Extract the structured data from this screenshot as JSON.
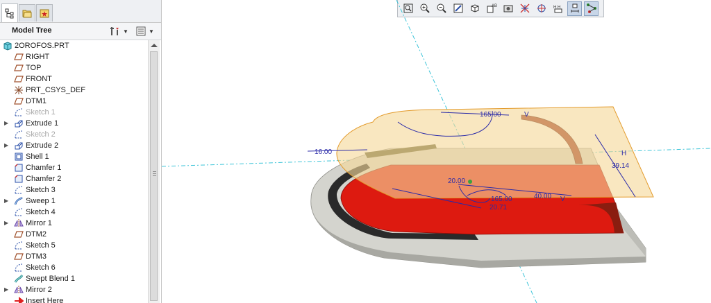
{
  "tabs": [
    {
      "name": "model-tree-tab-icon"
    },
    {
      "name": "folder-browser-tab-icon"
    },
    {
      "name": "favorites-tab-icon"
    }
  ],
  "tree_header": {
    "title": "Model Tree"
  },
  "tree": {
    "items": [
      {
        "label": "2OROFOS.PRT",
        "icon": "part-icon",
        "level": 0,
        "expand": false,
        "dim": false
      },
      {
        "label": "RIGHT",
        "icon": "datum-plane-icon",
        "level": 1,
        "expand": false,
        "dim": false
      },
      {
        "label": "TOP",
        "icon": "datum-plane-icon",
        "level": 1,
        "expand": false,
        "dim": false
      },
      {
        "label": "FRONT",
        "icon": "datum-plane-icon",
        "level": 1,
        "expand": false,
        "dim": false
      },
      {
        "label": "PRT_CSYS_DEF",
        "icon": "coordinate-system-icon",
        "level": 1,
        "expand": false,
        "dim": false
      },
      {
        "label": "DTM1",
        "icon": "datum-plane-icon",
        "level": 1,
        "expand": false,
        "dim": false
      },
      {
        "label": "Sketch 1",
        "icon": "sketch-icon",
        "level": 1,
        "expand": false,
        "dim": true
      },
      {
        "label": "Extrude 1",
        "icon": "extrude-icon",
        "level": 1,
        "expand": true,
        "dim": false
      },
      {
        "label": "Sketch 2",
        "icon": "sketch-icon",
        "level": 1,
        "expand": false,
        "dim": true
      },
      {
        "label": "Extrude 2",
        "icon": "extrude-icon",
        "level": 1,
        "expand": true,
        "dim": false
      },
      {
        "label": "Shell 1",
        "icon": "shell-icon",
        "level": 1,
        "expand": false,
        "dim": false
      },
      {
        "label": "Chamfer 1",
        "icon": "chamfer-icon",
        "level": 1,
        "expand": false,
        "dim": false
      },
      {
        "label": "Chamfer 2",
        "icon": "chamfer-icon",
        "level": 1,
        "expand": false,
        "dim": false
      },
      {
        "label": "Sketch 3",
        "icon": "sketch-icon",
        "level": 1,
        "expand": false,
        "dim": false
      },
      {
        "label": "Sweep 1",
        "icon": "sweep-icon",
        "level": 1,
        "expand": true,
        "dim": false
      },
      {
        "label": "Sketch 4",
        "icon": "sketch-icon",
        "level": 1,
        "expand": false,
        "dim": false
      },
      {
        "label": "Mirror 1",
        "icon": "mirror-icon",
        "level": 1,
        "expand": true,
        "dim": false
      },
      {
        "label": "DTM2",
        "icon": "datum-plane-icon",
        "level": 1,
        "expand": false,
        "dim": false
      },
      {
        "label": "Sketch 5",
        "icon": "sketch-icon",
        "level": 1,
        "expand": false,
        "dim": false
      },
      {
        "label": "DTM3",
        "icon": "datum-plane-icon",
        "level": 1,
        "expand": false,
        "dim": false
      },
      {
        "label": "Sketch 6",
        "icon": "sketch-icon",
        "level": 1,
        "expand": false,
        "dim": false
      },
      {
        "label": "Swept Blend 1",
        "icon": "swept-blend-icon",
        "level": 1,
        "expand": false,
        "dim": false
      },
      {
        "label": "Mirror 2",
        "icon": "mirror-icon",
        "level": 1,
        "expand": true,
        "dim": false
      },
      {
        "label": "Insert Here",
        "icon": "insert-here-icon",
        "level": 1,
        "expand": false,
        "dim": false
      }
    ]
  },
  "view_toolbar": {
    "buttons": [
      {
        "name": "refit-icon",
        "active": false
      },
      {
        "name": "zoom-in-icon",
        "active": false
      },
      {
        "name": "zoom-out-icon",
        "active": false
      },
      {
        "name": "repaint-icon",
        "active": false
      },
      {
        "name": "display-style-icon",
        "active": false
      },
      {
        "name": "saved-orientations-icon",
        "active": false
      },
      {
        "name": "view-manager-icon",
        "active": false
      },
      {
        "name": "datum-display-filters-icon",
        "active": false
      },
      {
        "name": "spin-center-icon",
        "active": false
      },
      {
        "name": "annotation-display-icon",
        "active": false
      },
      {
        "name": "dimension-display-icon",
        "active": true
      },
      {
        "name": "constraint-display-icon",
        "active": true
      }
    ]
  },
  "dimensions": {
    "d1": "16.00",
    "d2": "165.00",
    "d3": "20.00",
    "d4": "165.00",
    "d5": "20.71",
    "d6": "40.00",
    "d7": "39.14",
    "v1": "V",
    "v2": "V",
    "h1": "H"
  },
  "colors": {
    "accent": "#2a2aa8",
    "sketch_plane": "#f5d99a",
    "solid_red": "#dd1a10",
    "solid_gray": "#d2d2cc",
    "datum_axis": "#3cc4d8"
  }
}
